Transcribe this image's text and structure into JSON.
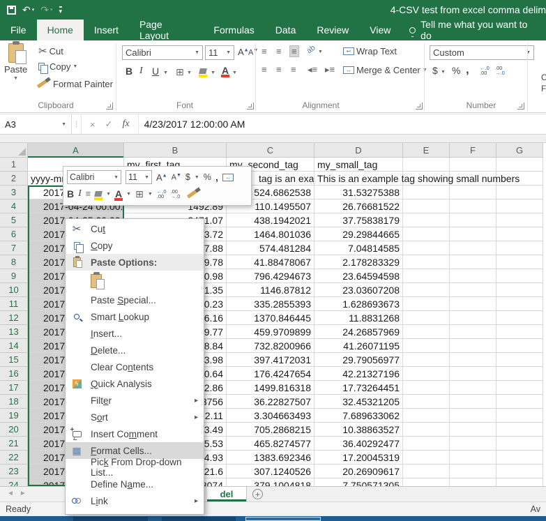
{
  "titlebar": {
    "title": "4-CSV test from excel comma delim"
  },
  "tabs": {
    "items": [
      {
        "id": "file",
        "label": "File",
        "active": false
      },
      {
        "id": "home",
        "label": "Home",
        "active": true
      },
      {
        "id": "insert",
        "label": "Insert",
        "active": false
      },
      {
        "id": "page-layout",
        "label": "Page Layout",
        "active": false
      },
      {
        "id": "formulas",
        "label": "Formulas",
        "active": false
      },
      {
        "id": "data",
        "label": "Data",
        "active": false
      },
      {
        "id": "review",
        "label": "Review",
        "active": false
      },
      {
        "id": "view",
        "label": "View",
        "active": false
      }
    ],
    "tellme": "Tell me what you want to do"
  },
  "ribbon": {
    "clipboard": {
      "label": "Clipboard",
      "paste": "Paste",
      "cut": "Cut",
      "copy": "Copy",
      "format_painter": "Format Painter"
    },
    "font": {
      "label": "Font",
      "family": "Calibri",
      "size": "11",
      "bold": "B",
      "italic": "I",
      "underline": "U"
    },
    "alignment": {
      "label": "Alignment",
      "wrap_text": "Wrap Text",
      "merge_center": "Merge & Center"
    },
    "number": {
      "label": "Number",
      "format": "Custom",
      "currency": "$",
      "percent": "%",
      "comma": ","
    },
    "cutoff": {
      "line1": "C",
      "line2": "F"
    }
  },
  "formula_bar": {
    "name_box": "A3",
    "fx": "fx",
    "value": "4/23/2017  12:00:00 AM"
  },
  "grid": {
    "col_headers": [
      "A",
      "B",
      "C",
      "D",
      "E",
      "F",
      "G"
    ],
    "selected_column": "A",
    "row1": {
      "b": "my_first_tag",
      "c": "my_second_tag",
      "d": "my_small_tag"
    },
    "row2": {
      "a": "yyyy-mm-",
      "c_overflow": "tag is an examp",
      "d": "This is an example tag showing small numbers"
    },
    "data_rows": [
      {
        "n": 3,
        "a": "2017-04-23 00:00:00",
        "b": "",
        "c": "524.6862538",
        "d": "31.53275388"
      },
      {
        "n": 4,
        "a": "2017-04-24 00:00:00",
        "b": "1492.89",
        "c": "110.1495507",
        "d": "26.76681522"
      },
      {
        "n": 5,
        "a": "2017-04-25 00:00:00",
        "b": "2471.07",
        "c": "438.1942021",
        "d": "37.75838179"
      },
      {
        "n": 6,
        "a": "2017-",
        "b": "3.72",
        "c": "1464.801036",
        "d": "29.29844665"
      },
      {
        "n": 7,
        "a": "2017-",
        "b": "7.88",
        "c": "574.481284",
        "d": "7.04814585"
      },
      {
        "n": 8,
        "a": "2017-",
        "b": "9.78",
        "c": "41.88478067",
        "d": "2.178283329"
      },
      {
        "n": 9,
        "a": "2017-",
        "b": "0.98",
        "c": "796.4294673",
        "d": "23.64594598"
      },
      {
        "n": 10,
        "a": "2017-",
        "b": "1.35",
        "c": "1146.87812",
        "d": "23.03607208"
      },
      {
        "n": 11,
        "a": "2017-",
        "b": "0.23",
        "c": "335.2855393",
        "d": "1.628693673"
      },
      {
        "n": 12,
        "a": "2017-",
        "b": "6.16",
        "c": "1370.846445",
        "d": "11.8831268"
      },
      {
        "n": 13,
        "a": "2017-",
        "b": "9.77",
        "c": "459.9709899",
        "d": "24.26857969"
      },
      {
        "n": 14,
        "a": "2017-",
        "b": "8.84",
        "c": "732.8200966",
        "d": "41.26071195"
      },
      {
        "n": 15,
        "a": "2017-",
        "b": "3.98",
        "c": "397.4172031",
        "d": "29.79056977"
      },
      {
        "n": 16,
        "a": "2017-",
        "b": "0.64",
        "c": "176.4247654",
        "d": "42.21327196"
      },
      {
        "n": 17,
        "a": "2017-",
        "b": "2.86",
        "c": "1499.816318",
        "d": "17.73264451"
      },
      {
        "n": 18,
        "a": "2017-",
        "b": "3756",
        "c": "36.22827507",
        "d": "32.45321205"
      },
      {
        "n": 19,
        "a": "2017-",
        "b": "2.11",
        "c": "3.304663493",
        "d": "7.689633062"
      },
      {
        "n": 20,
        "a": "2017-",
        "b": "3.49",
        "c": "705.2868215",
        "d": "10.38863527"
      },
      {
        "n": 21,
        "a": "2017-",
        "b": "5.53",
        "c": "465.8274577",
        "d": "36.40292477"
      },
      {
        "n": 22,
        "a": "2017-",
        "b": "4.93",
        "c": "1383.692346",
        "d": "17.20045319"
      },
      {
        "n": 23,
        "a": "2017-",
        "b": "21.6",
        "c": "307.1240526",
        "d": "20.26909617"
      },
      {
        "n": 24,
        "a": "2017-",
        "b": "8074",
        "c": "379.1004818",
        "d": "7.750571305"
      }
    ]
  },
  "mini_toolbar": {
    "font": "Calibri",
    "size": "11",
    "bold": "B",
    "italic": "I"
  },
  "context_menu": {
    "items": [
      {
        "id": "cut",
        "label": "Cut",
        "accel": 2,
        "icon": "scissors-icon"
      },
      {
        "id": "copy",
        "label": "Copy",
        "accel": 0,
        "icon": "copy-icon"
      },
      {
        "id": "paste-options",
        "label": "Paste Options:",
        "icon": "paste-icon",
        "header": true
      },
      {
        "id": "paste-keep-formatting",
        "icon": "paste-icon",
        "paste_button": true
      },
      {
        "id": "paste-special",
        "label": "Paste Special...",
        "accel": 6
      },
      {
        "id": "smart-lookup",
        "label": "Smart Lookup",
        "accel": 6,
        "icon": "magnifier-icon"
      },
      {
        "id": "insert",
        "label": "Insert...",
        "accel": 0
      },
      {
        "id": "delete",
        "label": "Delete...",
        "accel": 0
      },
      {
        "id": "clear-contents",
        "label": "Clear Contents",
        "accel": 8
      },
      {
        "id": "quick-analysis",
        "label": "Quick Analysis",
        "accel": 0,
        "icon": "quick-analysis-icon"
      },
      {
        "id": "filter",
        "label": "Filter",
        "accel": 4,
        "submenu": true
      },
      {
        "id": "sort",
        "label": "Sort",
        "accel": 1,
        "submenu": true
      },
      {
        "id": "insert-comment",
        "label": "Insert Comment",
        "accel": 9,
        "icon": "comment-icon"
      },
      {
        "id": "format-cells",
        "label": "Format Cells...",
        "accel": 0,
        "icon": "format-cells-icon",
        "highlighted": true
      },
      {
        "id": "pick-from-drop-down-list",
        "label": "Pick From Drop-down List...",
        "accel": 3
      },
      {
        "id": "define-name",
        "label": "Define Name...",
        "accel": 8
      },
      {
        "id": "link",
        "label": "Link",
        "accel": 1,
        "icon": "link-icon",
        "submenu": true
      }
    ]
  },
  "sheet_bar": {
    "active_tab": "del",
    "new_sheet": "+"
  },
  "status_bar": {
    "left": "Ready",
    "right": "Av"
  }
}
